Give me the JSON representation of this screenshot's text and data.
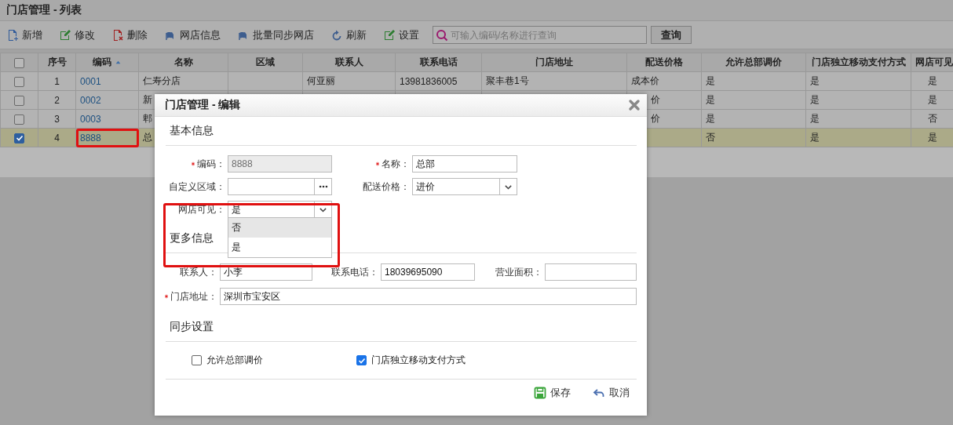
{
  "page": {
    "title": "门店管理 - 列表"
  },
  "toolbar": {
    "buttons": [
      {
        "label": "新增",
        "kind": "new"
      },
      {
        "label": "修改",
        "kind": "edit"
      },
      {
        "label": "删除",
        "kind": "delete"
      },
      {
        "label": "网店信息",
        "kind": "shop"
      },
      {
        "label": "批量同步网店",
        "kind": "shop"
      },
      {
        "label": "刷新",
        "kind": "refresh"
      },
      {
        "label": "设置",
        "kind": "edit"
      }
    ],
    "search": {
      "placeholder": "可输入编码/名称进行查询"
    },
    "query_button": "查询"
  },
  "table": {
    "all_checked": false,
    "columns": [
      {
        "label": "序号",
        "sorted": false
      },
      {
        "label": "编码",
        "sorted": true
      },
      {
        "label": "名称",
        "sorted": false
      },
      {
        "label": "区域",
        "sorted": false
      },
      {
        "label": "联系人",
        "sorted": false
      },
      {
        "label": "联系电话",
        "sorted": false
      },
      {
        "label": "门店地址",
        "sorted": false
      },
      {
        "label": "配送价格",
        "sorted": false
      },
      {
        "label": "允许总部调价",
        "sorted": false
      },
      {
        "label": "门店独立移动支付方式",
        "sorted": false
      },
      {
        "label": "网店可见",
        "sorted": false
      }
    ],
    "rows": [
      {
        "checked": false,
        "selected": false,
        "code_highlighted": false,
        "cells": [
          "1",
          "0001",
          "仁寿分店",
          null,
          "何亚丽",
          "13981836005",
          "聚丰巷1号",
          "成本价",
          "是",
          "是",
          "是"
        ]
      },
      {
        "checked": false,
        "selected": false,
        "code_highlighted": false,
        "cells": [
          "2",
          "0002",
          "新",
          null,
          null,
          null,
          null,
          {
            "text": "价",
            "clipped": true
          },
          "是",
          "是",
          "是"
        ]
      },
      {
        "checked": false,
        "selected": false,
        "code_highlighted": false,
        "cells": [
          "3",
          "0003",
          "郫",
          null,
          null,
          null,
          null,
          {
            "text": "价",
            "clipped": true
          },
          "是",
          "是",
          "否"
        ]
      },
      {
        "checked": true,
        "selected": true,
        "code_highlighted": true,
        "cells": [
          "4",
          "8888",
          "总",
          null,
          null,
          null,
          null,
          null,
          "否",
          "是",
          "是"
        ]
      }
    ]
  },
  "dialog": {
    "title": "门店管理 - 编辑",
    "basic": {
      "heading": "基本信息",
      "fields": [
        {
          "label": "编码：",
          "required": true,
          "kind": "text",
          "value": "8888",
          "disabled": true
        },
        {
          "label": "名称：",
          "required": true,
          "kind": "text",
          "value": "总部",
          "disabled": false
        },
        {
          "label": "自定义区域：",
          "required": false,
          "kind": "picker",
          "disabled": false
        },
        {
          "label": "配送价格：",
          "required": false,
          "kind": "select",
          "value": "进价",
          "disabled": false,
          "expanded": false
        },
        {
          "label": "网店可见：",
          "required": false,
          "kind": "select",
          "value": "是",
          "disabled": false,
          "expanded": true,
          "highlighted": true,
          "options": [
            {
              "label": "否",
              "hovered": true
            },
            {
              "label": "是",
              "hovered": false
            }
          ]
        }
      ]
    },
    "more": {
      "heading": "更多信息",
      "fields": [
        {
          "label": "联系人：",
          "required": false,
          "kind": "text",
          "value": "小李"
        },
        {
          "label": "联系电话：",
          "required": false,
          "kind": "text",
          "value": "18039695090"
        },
        {
          "label": "营业面积：",
          "required": false,
          "kind": "text"
        },
        {
          "label": "门店地址：",
          "required": true,
          "kind": "wide",
          "value": "深圳市宝安区"
        }
      ]
    },
    "sync": {
      "heading": "同步设置",
      "options": [
        {
          "label": "允许总部调价",
          "checked": false
        },
        {
          "label": "门店独立移动支付方式",
          "checked": true
        }
      ]
    },
    "buttons": [
      {
        "label": "保存",
        "kind": "save"
      },
      {
        "label": "取消",
        "kind": "cancel"
      }
    ]
  }
}
